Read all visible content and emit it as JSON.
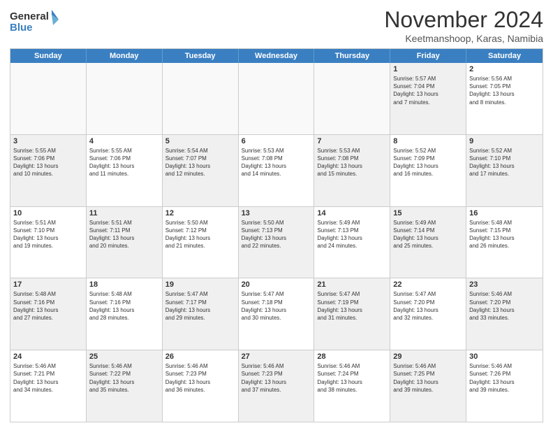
{
  "logo": {
    "line1": "General",
    "line2": "Blue"
  },
  "title": "November 2024",
  "subtitle": "Keetmanshoop, Karas, Namibia",
  "days_of_week": [
    "Sunday",
    "Monday",
    "Tuesday",
    "Wednesday",
    "Thursday",
    "Friday",
    "Saturday"
  ],
  "weeks": [
    [
      {
        "day": "",
        "detail": "",
        "empty": true
      },
      {
        "day": "",
        "detail": "",
        "empty": true
      },
      {
        "day": "",
        "detail": "",
        "empty": true
      },
      {
        "day": "",
        "detail": "",
        "empty": true
      },
      {
        "day": "",
        "detail": "",
        "empty": true
      },
      {
        "day": "1",
        "detail": "Sunrise: 5:57 AM\nSunset: 7:04 PM\nDaylight: 13 hours\nand 7 minutes.",
        "shaded": true
      },
      {
        "day": "2",
        "detail": "Sunrise: 5:56 AM\nSunset: 7:05 PM\nDaylight: 13 hours\nand 8 minutes.",
        "shaded": false
      }
    ],
    [
      {
        "day": "3",
        "detail": "Sunrise: 5:55 AM\nSunset: 7:06 PM\nDaylight: 13 hours\nand 10 minutes.",
        "shaded": true
      },
      {
        "day": "4",
        "detail": "Sunrise: 5:55 AM\nSunset: 7:06 PM\nDaylight: 13 hours\nand 11 minutes.",
        "shaded": false
      },
      {
        "day": "5",
        "detail": "Sunrise: 5:54 AM\nSunset: 7:07 PM\nDaylight: 13 hours\nand 12 minutes.",
        "shaded": true
      },
      {
        "day": "6",
        "detail": "Sunrise: 5:53 AM\nSunset: 7:08 PM\nDaylight: 13 hours\nand 14 minutes.",
        "shaded": false
      },
      {
        "day": "7",
        "detail": "Sunrise: 5:53 AM\nSunset: 7:08 PM\nDaylight: 13 hours\nand 15 minutes.",
        "shaded": true
      },
      {
        "day": "8",
        "detail": "Sunrise: 5:52 AM\nSunset: 7:09 PM\nDaylight: 13 hours\nand 16 minutes.",
        "shaded": false
      },
      {
        "day": "9",
        "detail": "Sunrise: 5:52 AM\nSunset: 7:10 PM\nDaylight: 13 hours\nand 17 minutes.",
        "shaded": true
      }
    ],
    [
      {
        "day": "10",
        "detail": "Sunrise: 5:51 AM\nSunset: 7:10 PM\nDaylight: 13 hours\nand 19 minutes.",
        "shaded": false
      },
      {
        "day": "11",
        "detail": "Sunrise: 5:51 AM\nSunset: 7:11 PM\nDaylight: 13 hours\nand 20 minutes.",
        "shaded": true
      },
      {
        "day": "12",
        "detail": "Sunrise: 5:50 AM\nSunset: 7:12 PM\nDaylight: 13 hours\nand 21 minutes.",
        "shaded": false
      },
      {
        "day": "13",
        "detail": "Sunrise: 5:50 AM\nSunset: 7:13 PM\nDaylight: 13 hours\nand 22 minutes.",
        "shaded": true
      },
      {
        "day": "14",
        "detail": "Sunrise: 5:49 AM\nSunset: 7:13 PM\nDaylight: 13 hours\nand 24 minutes.",
        "shaded": false
      },
      {
        "day": "15",
        "detail": "Sunrise: 5:49 AM\nSunset: 7:14 PM\nDaylight: 13 hours\nand 25 minutes.",
        "shaded": true
      },
      {
        "day": "16",
        "detail": "Sunrise: 5:48 AM\nSunset: 7:15 PM\nDaylight: 13 hours\nand 26 minutes.",
        "shaded": false
      }
    ],
    [
      {
        "day": "17",
        "detail": "Sunrise: 5:48 AM\nSunset: 7:16 PM\nDaylight: 13 hours\nand 27 minutes.",
        "shaded": true
      },
      {
        "day": "18",
        "detail": "Sunrise: 5:48 AM\nSunset: 7:16 PM\nDaylight: 13 hours\nand 28 minutes.",
        "shaded": false
      },
      {
        "day": "19",
        "detail": "Sunrise: 5:47 AM\nSunset: 7:17 PM\nDaylight: 13 hours\nand 29 minutes.",
        "shaded": true
      },
      {
        "day": "20",
        "detail": "Sunrise: 5:47 AM\nSunset: 7:18 PM\nDaylight: 13 hours\nand 30 minutes.",
        "shaded": false
      },
      {
        "day": "21",
        "detail": "Sunrise: 5:47 AM\nSunset: 7:19 PM\nDaylight: 13 hours\nand 31 minutes.",
        "shaded": true
      },
      {
        "day": "22",
        "detail": "Sunrise: 5:47 AM\nSunset: 7:20 PM\nDaylight: 13 hours\nand 32 minutes.",
        "shaded": false
      },
      {
        "day": "23",
        "detail": "Sunrise: 5:46 AM\nSunset: 7:20 PM\nDaylight: 13 hours\nand 33 minutes.",
        "shaded": true
      }
    ],
    [
      {
        "day": "24",
        "detail": "Sunrise: 5:46 AM\nSunset: 7:21 PM\nDaylight: 13 hours\nand 34 minutes.",
        "shaded": false
      },
      {
        "day": "25",
        "detail": "Sunrise: 5:46 AM\nSunset: 7:22 PM\nDaylight: 13 hours\nand 35 minutes.",
        "shaded": true
      },
      {
        "day": "26",
        "detail": "Sunrise: 5:46 AM\nSunset: 7:23 PM\nDaylight: 13 hours\nand 36 minutes.",
        "shaded": false
      },
      {
        "day": "27",
        "detail": "Sunrise: 5:46 AM\nSunset: 7:23 PM\nDaylight: 13 hours\nand 37 minutes.",
        "shaded": true
      },
      {
        "day": "28",
        "detail": "Sunrise: 5:46 AM\nSunset: 7:24 PM\nDaylight: 13 hours\nand 38 minutes.",
        "shaded": false
      },
      {
        "day": "29",
        "detail": "Sunrise: 5:46 AM\nSunset: 7:25 PM\nDaylight: 13 hours\nand 39 minutes.",
        "shaded": true
      },
      {
        "day": "30",
        "detail": "Sunrise: 5:46 AM\nSunset: 7:26 PM\nDaylight: 13 hours\nand 39 minutes.",
        "shaded": false
      }
    ]
  ]
}
